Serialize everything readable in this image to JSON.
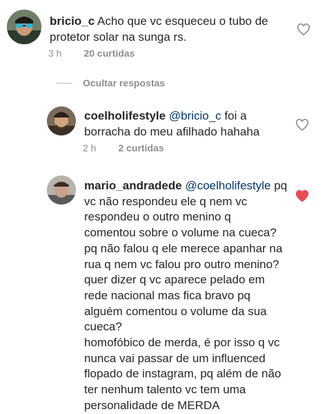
{
  "comments": [
    {
      "username": "bricio_c",
      "mention": "",
      "text": "Acho que vc esqueceu o tubo de\nprotetor solar na sunga rs.",
      "time": "3 h",
      "likes": "20 curtidas",
      "liked": false
    },
    {
      "username": "coelholifestyle",
      "mention": "@bricio_c",
      "text": "foi a\nborracha do meu afilhado hahaha",
      "time": "2 h",
      "likes": "2 curtidas",
      "liked": false
    },
    {
      "username": "mario_andradede",
      "mention": "@coelholifestyle",
      "text": "pq\nvc não respondeu ele q nem vc\nrespondeu o outro menino q\ncomentou sobre o volume na cueca?\npq não falou q ele merece apanhar na\nrua q nem vc falou pro outro menino?\nquer dizer q vc aparece pelado em\nrede nacional mas fica bravo pq\nalguém comentou o volume da sua\ncueca?\nhomofóbico de merda, é por isso q vc\nnunca vai passar de um influenced\nflopado de instagram, pq além de não\nter nenhum talento vc tem uma\npersonalidade de MERDA",
      "liked": true
    }
  ],
  "replies_toggle": "Ocultar respostas",
  "colors": {
    "liked_heart": "#ed4956",
    "unliked_heart": "#8e8e8e",
    "mention": "#00376b",
    "meta": "#8e8e8e"
  },
  "icons": [
    "heart-outline-icon",
    "heart-filled-icon"
  ]
}
